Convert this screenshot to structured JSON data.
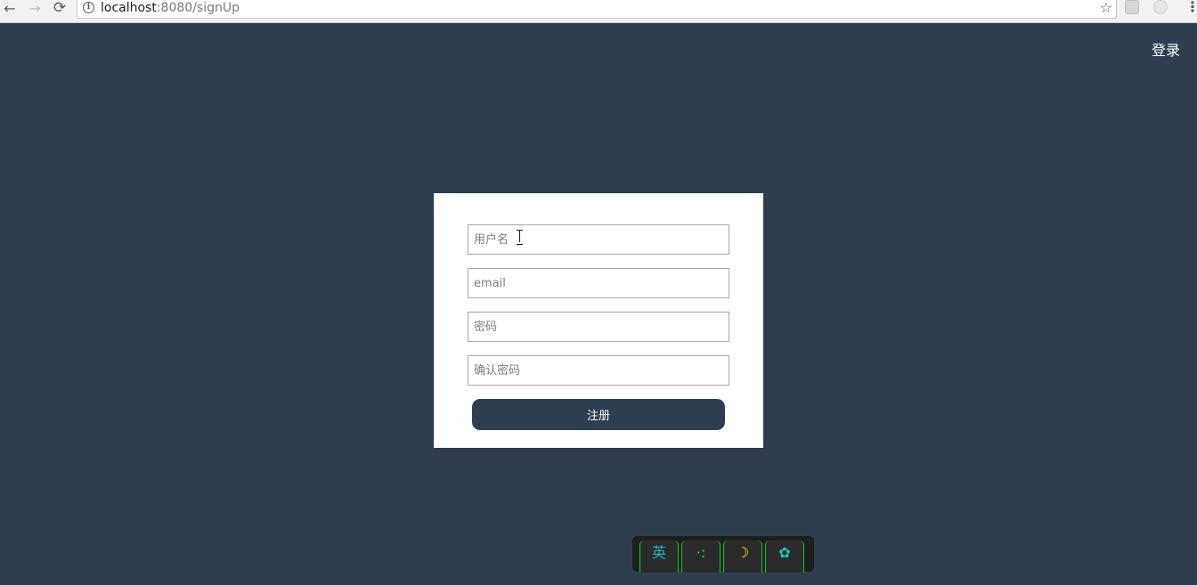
{
  "browser": {
    "url_host": "localhost",
    "url_rest": ":8080/signUp",
    "icons": {
      "back": "back-arrow-icon",
      "forward": "forward-arrow-icon",
      "reload": "reload-icon",
      "info": "info-icon",
      "star": "bookmark-star-icon",
      "menu": "menu-dots-icon"
    },
    "back_glyph": "←",
    "forward_glyph": "→",
    "reload_glyph": "⟳",
    "info_glyph": "i",
    "star_glyph": "☆",
    "menu_glyph": "⋮"
  },
  "header": {
    "login_link": "登录"
  },
  "signup_form": {
    "username_placeholder": "用户名",
    "email_placeholder": "email",
    "password_placeholder": "密码",
    "confirm_password_placeholder": "确认密码",
    "submit_label": "注册"
  },
  "ime_toolbar": {
    "keys": [
      {
        "label": "英",
        "color": "#1fb6c8"
      },
      {
        "label": "·:",
        "color": "#2bd94a"
      },
      {
        "label": "☽",
        "color": "#f3e328"
      },
      {
        "label": "✿",
        "color": "#15c9b9"
      }
    ]
  },
  "colors": {
    "page_background": "#2f3e4f",
    "card_background": "#ffffff",
    "button_background": "#2f3e4f",
    "button_text": "#ffffff",
    "field_border": "#a7a7a7"
  }
}
